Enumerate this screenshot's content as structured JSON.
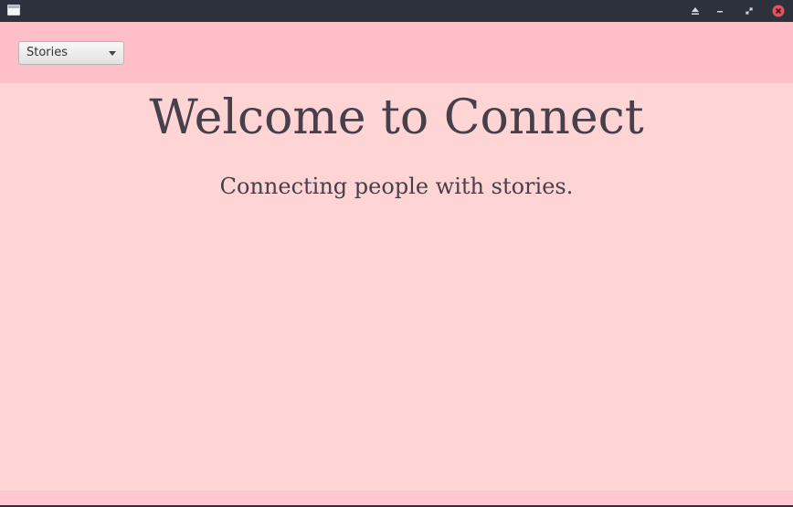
{
  "window": {
    "titlebar_color": "#2d313c",
    "icons": {
      "app": "window-icon",
      "shade": "eject-icon",
      "minimize": "minimize-icon",
      "maximize": "maximize-icon",
      "close": "close-icon"
    }
  },
  "toolbar": {
    "background": "#ffbfc9",
    "combo": {
      "selected": "Stories",
      "arrow_icon": "chevron-down-icon"
    }
  },
  "main": {
    "background": "#ffd4d4",
    "title": "Welcome to Connect",
    "tagline": "Connecting people with stories."
  }
}
